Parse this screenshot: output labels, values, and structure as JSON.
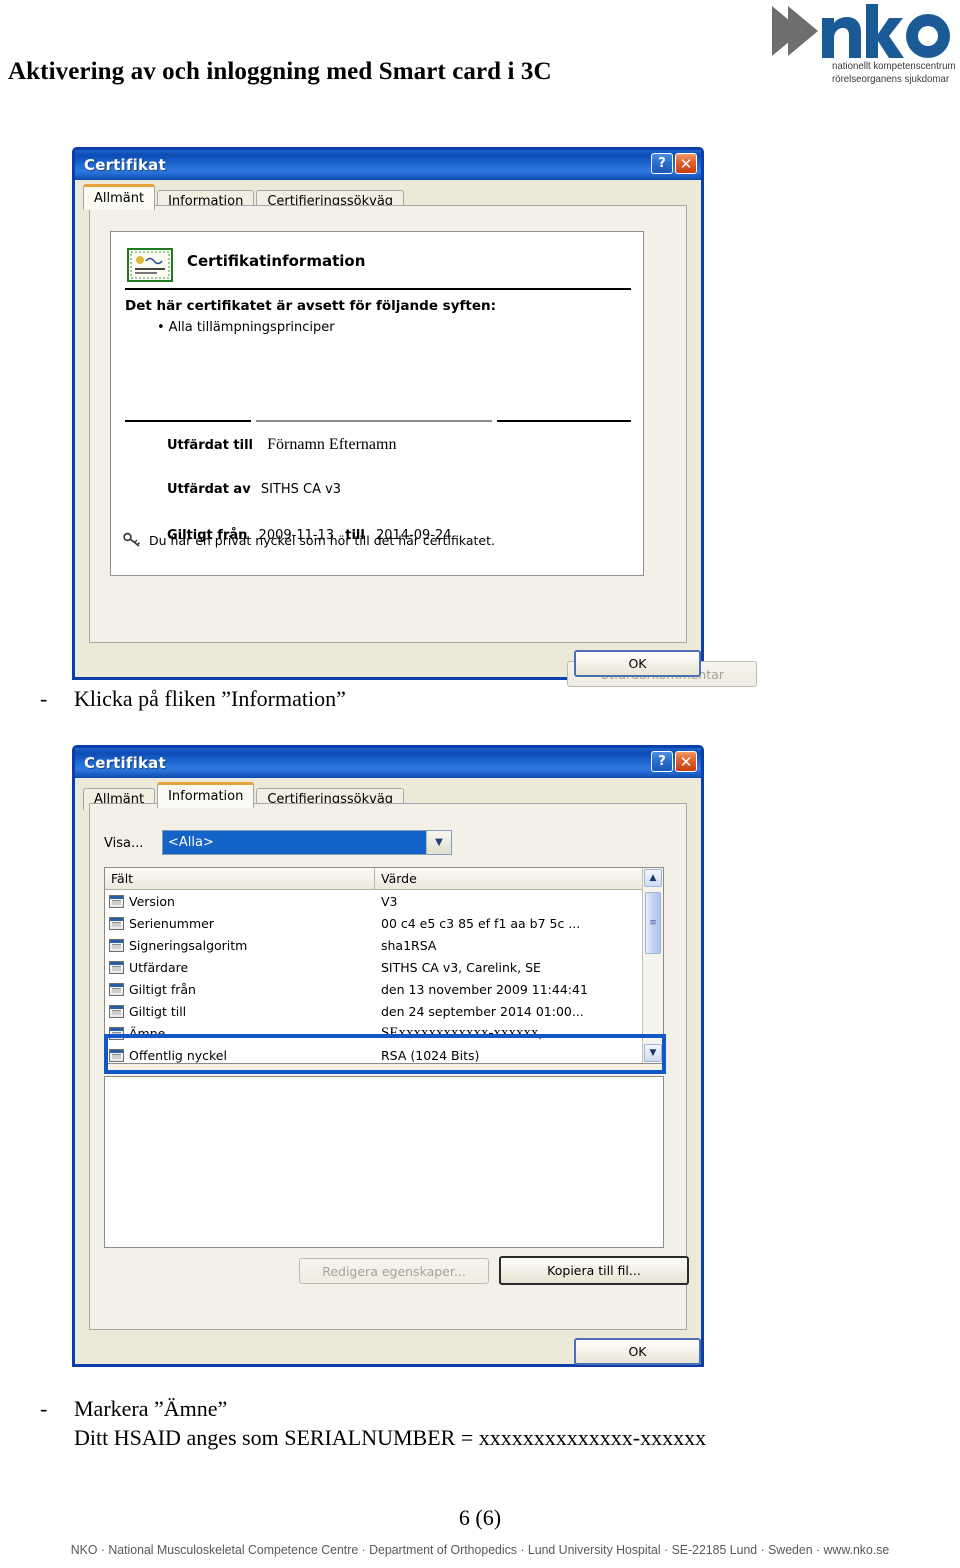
{
  "document": {
    "title": "Aktivering av och inloggning med Smart card i 3C",
    "page_number": "6 (6)",
    "footer": "NKO · National Musculoskeletal Competence Centre · Department of Orthopedics · Lund University Hospital · SE-22185 Lund · Sweden · www.nko.se"
  },
  "logo": {
    "wordmark": "nko",
    "tagline_line1": "nationellt kompetenscentrum",
    "tagline_line2": "rörelseorganens sjukdomar",
    "brand_blue": "#1a5a96",
    "brand_gray": "#6e6e6e"
  },
  "steps": [
    {
      "dash": "-",
      "text": "Klicka på fliken ”Information”"
    },
    {
      "dash": "-",
      "text": "Markera ”Ämne”"
    },
    {
      "dash": "",
      "text": "Ditt HSAID anges som SERIALNUMBER = xxxxxxxxxxxxxx-xxxxxx"
    }
  ],
  "dialog_general": {
    "title": "Certifikat",
    "titlebar_help": "?",
    "titlebar_close": "✕",
    "tabs": [
      {
        "label": "Allmänt",
        "active": true
      },
      {
        "label": "Information",
        "active": false
      },
      {
        "label": "Certifieringssökväg",
        "active": false
      }
    ],
    "cert_info_heading": "Certifikatinformation",
    "purpose_heading": "Det här certifikatet är avsett för följande syften:",
    "purpose_items": [
      "Alla tillämpningsprinciper"
    ],
    "issued_to_label": "Utfärdat till",
    "issued_to_value": "Förnamn Efternamn",
    "issued_by_label": "Utfärdat av",
    "issued_by_value": "SITHS CA v3",
    "valid_from_label": "Giltigt från",
    "valid_from_value": "2009-11-13",
    "valid_to_label": "till",
    "valid_to_value": "2014-09-24",
    "private_key_note": "Du har en privat nyckel som hör till det här certifikatet.",
    "issuer_comment_button": "Utfärdarkommentar",
    "ok_button": "OK"
  },
  "dialog_details": {
    "title": "Certifikat",
    "titlebar_help": "?",
    "titlebar_close": "✕",
    "tabs": [
      {
        "label": "Allmänt",
        "active": false
      },
      {
        "label": "Information",
        "active": true
      },
      {
        "label": "Certifieringssökväg",
        "active": false
      }
    ],
    "show_label": "Visa...",
    "show_value": "<Alla>",
    "columns": [
      "Fält",
      "Värde"
    ],
    "rows": [
      {
        "field": "Version",
        "value": "V3",
        "selected": false,
        "serif": false
      },
      {
        "field": "Serienummer",
        "value": "00 c4 e5 c3 85 ef f1 aa b7 5c ...",
        "selected": false,
        "serif": false
      },
      {
        "field": "Signeringsalgoritm",
        "value": "sha1RSA",
        "selected": false,
        "serif": false
      },
      {
        "field": "Utfärdare",
        "value": "SITHS CA v3, Carelink, SE",
        "selected": false,
        "serif": false
      },
      {
        "field": "Giltigt från",
        "value": "den 13 november 2009 11:44:41",
        "selected": false,
        "serif": false
      },
      {
        "field": "Giltigt till",
        "value": "den 24 september 2014 01:00...",
        "selected": false,
        "serif": false
      },
      {
        "field": "Ämne",
        "value": "SExxxxxxxxxxxx-xxxxxx,      ..",
        "selected": true,
        "serif": true
      },
      {
        "field": "Offentlig nyckel",
        "value": "RSA (1024 Bits)",
        "selected": false,
        "serif": false
      }
    ],
    "edit_properties_button": "Redigera egenskaper...",
    "copy_to_file_button": "Kopiera till fil...",
    "ok_button": "OK"
  },
  "colors": {
    "titlebar_blue": "#0d4cb5",
    "dialog_border": "#0a3ea8",
    "dialog_face": "#ece9d8",
    "highlight_blue": "#1157c6",
    "selection_blue": "#1463c6"
  }
}
